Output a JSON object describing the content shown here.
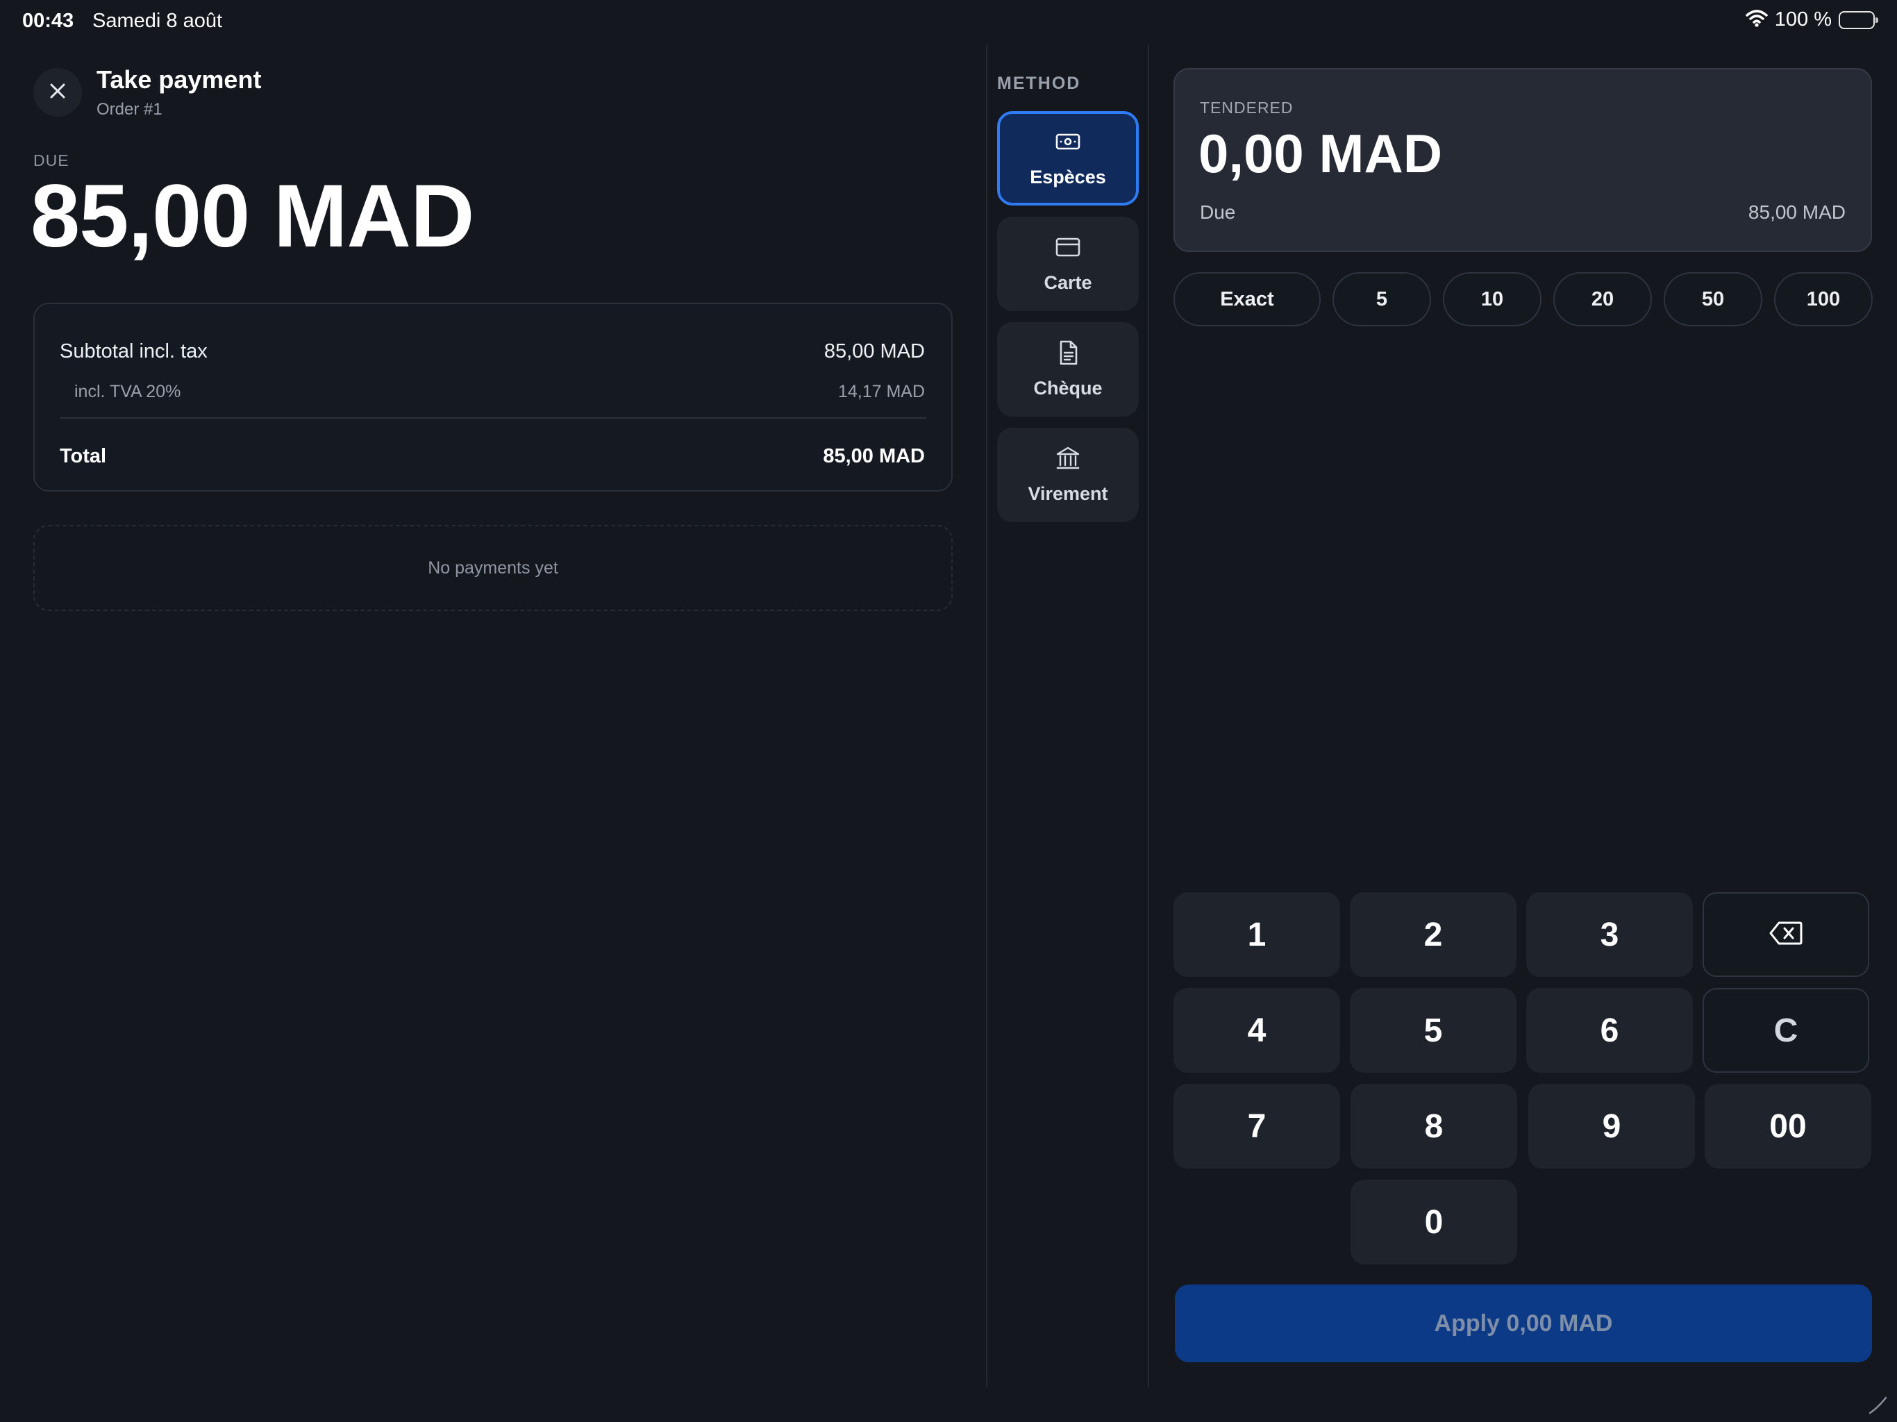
{
  "status_bar": {
    "time": "00:43",
    "date": "Samedi 8 août",
    "battery_text": "100 %"
  },
  "header": {
    "title": "Take payment",
    "subtitle": "Order #1"
  },
  "due": {
    "label": "DUE",
    "amount": "85,00 MAD"
  },
  "summary": {
    "subtotal_label": "Subtotal incl. tax",
    "subtotal_value": "85,00 MAD",
    "tax_label": "incl. TVA 20%",
    "tax_value": "14,17 MAD",
    "total_label": "Total",
    "total_value": "85,00 MAD"
  },
  "payments": {
    "empty_text": "No payments yet"
  },
  "method": {
    "label": "METHOD",
    "items": [
      {
        "label": "Espèces",
        "icon": "cash-icon",
        "selected": true
      },
      {
        "label": "Carte",
        "icon": "card-icon",
        "selected": false
      },
      {
        "label": "Chèque",
        "icon": "document-icon",
        "selected": false
      },
      {
        "label": "Virement",
        "icon": "bank-icon",
        "selected": false
      }
    ]
  },
  "tender": {
    "label": "TENDERED",
    "amount": "0,00 MAD",
    "due_label": "Due",
    "due_value": "85,00 MAD"
  },
  "quick_amounts": [
    "Exact",
    "5",
    "10",
    "20",
    "50",
    "100"
  ],
  "keypad": {
    "keys": [
      "1",
      "2",
      "3",
      "4",
      "5",
      "6",
      "7",
      "8",
      "9",
      "0"
    ],
    "clear": "C",
    "double_zero": "00",
    "backspace_icon": "backspace-icon"
  },
  "apply_button": {
    "label": "Apply 0,00 MAD"
  },
  "colors": {
    "background": "#14171d",
    "accent": "#2f7bf5",
    "apply_bg": "#0d3a86"
  }
}
